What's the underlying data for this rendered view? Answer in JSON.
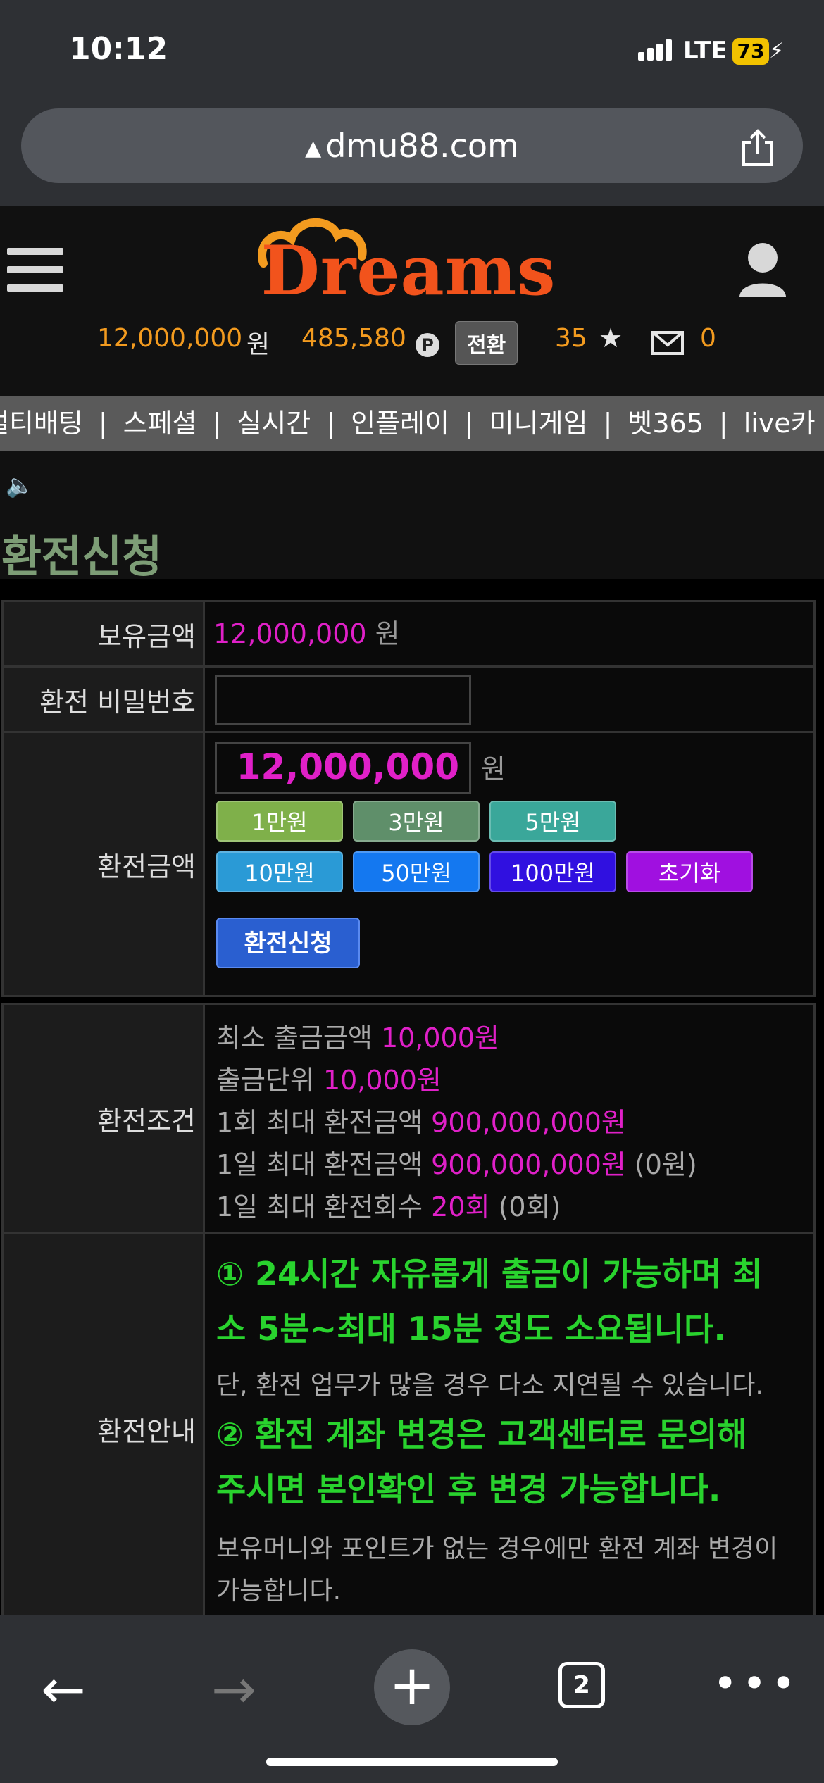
{
  "status": {
    "time": "10:12",
    "network": "LTE",
    "battery": "73"
  },
  "browser": {
    "url": "dmu88.com",
    "tab_count": "2"
  },
  "site": {
    "logo": "Dreams",
    "balance": "12,000,000",
    "balance_unit": "원",
    "points": "485,580",
    "points_badge": "P",
    "convert": "전환",
    "stars": "35",
    "messages": "0"
  },
  "nav": [
    "멀티배팅",
    "스페셜",
    "실시간",
    "인플레이",
    "미니게임",
    "벳365",
    "live카"
  ],
  "page": {
    "title": "환전신청"
  },
  "form": {
    "balance_label": "보유금액",
    "balance_value": "12,000,000",
    "balance_unit": "원",
    "password_label": "환전 비밀번호",
    "password_value": "",
    "amount_label": "환전금액",
    "amount_value": "12,000,000",
    "amount_unit": "원",
    "quick_buttons": [
      {
        "label": "1만원",
        "color": "#7fb04a"
      },
      {
        "label": "3만원",
        "color": "#5f8f6a"
      },
      {
        "label": "5만원",
        "color": "#3aa79a"
      },
      {
        "label": "10만원",
        "color": "#2a9ad6"
      },
      {
        "label": "50만원",
        "color": "#1478f0"
      },
      {
        "label": "100만원",
        "color": "#3010e0"
      },
      {
        "label": "초기화",
        "color": "#a010e0"
      }
    ],
    "submit": "환전신청"
  },
  "conditions": {
    "label": "환전조건",
    "lines": [
      {
        "text": "최소 출금금액",
        "value": "10,000원",
        "extra": ""
      },
      {
        "text": "출금단위",
        "value": "10,000원",
        "extra": ""
      },
      {
        "text": "1회 최대 환전금액",
        "value": "900,000,000원",
        "extra": ""
      },
      {
        "text": "1일 최대 환전금액",
        "value": "900,000,000원",
        "extra": "(0원)"
      },
      {
        "text": "1일 최대 환전회수",
        "value": "20회",
        "extra": "(0회)"
      }
    ]
  },
  "guide": {
    "label": "환전안내",
    "item1_line1": "① 24시간 자유롭게 출금이 가능하며 최",
    "item1_line2": "소 5분~최대 15분 정도 소요됩니다.",
    "item1_note": "단, 환전 업무가 많을 경우 다소 지연될 수 있습니다.",
    "item2_line1": "② 환전 계좌 변경은 고객센터로 문의해",
    "item2_line2": "주시면 본인확인 후 변경 가능합니다.",
    "item2_note": "보유머니와 포인트가 없는 경우에만 환전 계좌 변경이",
    "item2_note_cont": "가능합니다."
  }
}
